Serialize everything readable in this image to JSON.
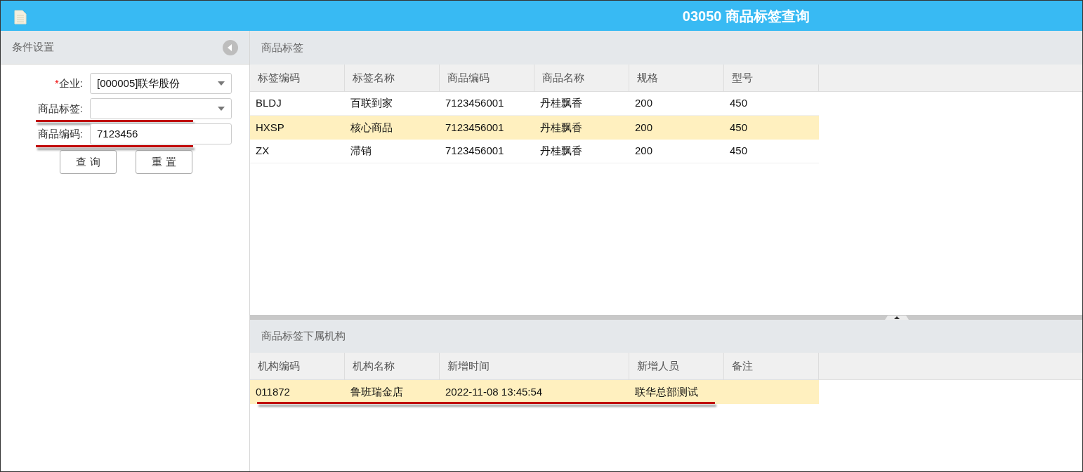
{
  "window": {
    "title": "03050 商品标签查询"
  },
  "conditions": {
    "title": "条件设置",
    "fields": [
      {
        "kind": "select",
        "required_mark": "*",
        "label": "企业:",
        "value": "[000005]联华股份"
      },
      {
        "kind": "select",
        "label": "商品标签:",
        "underlined": true
      },
      {
        "kind": "text",
        "label": "商品编码:",
        "value": "7123456",
        "underlined": true
      }
    ],
    "buttons": [
      "查 询",
      "重 置"
    ]
  },
  "tags_panel": {
    "title": "商品标签",
    "columns": [
      "标签编码",
      "标签名称",
      "商品编码",
      "商品名称",
      "规格",
      "型号"
    ],
    "rows": [
      {
        "cells": [
          "BLDJ",
          "百联到家",
          "7123456001",
          "丹桂飘香",
          "200",
          "450"
        ],
        "selected": false
      },
      {
        "cells": [
          "HXSP",
          "核心商品",
          "7123456001",
          "丹桂飘香",
          "200",
          "450"
        ],
        "selected": true
      },
      {
        "cells": [
          "ZX",
          "滞销",
          "7123456001",
          "丹桂飘香",
          "200",
          "450"
        ],
        "selected": false
      }
    ]
  },
  "org_panel": {
    "title": "商品标签下属机构",
    "columns": [
      "机构编码",
      "机构名称",
      "新增时间",
      "新增人员",
      "备注"
    ],
    "rows": [
      {
        "cells": [
          "011872",
          "鲁班瑞金店",
          "2022-11-08 13:45:54",
          "联华总部测试",
          ""
        ],
        "selected": true,
        "underlined": true
      }
    ]
  }
}
